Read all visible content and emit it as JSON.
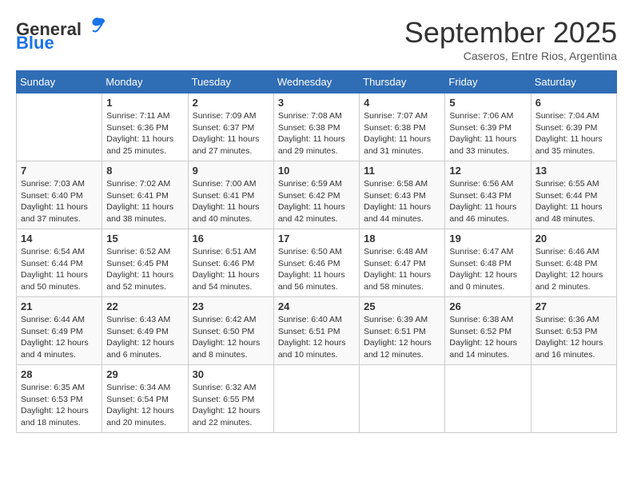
{
  "logo": {
    "line1": "General",
    "line2": "Blue"
  },
  "title": "September 2025",
  "subtitle": "Caseros, Entre Rios, Argentina",
  "days_of_week": [
    "Sunday",
    "Monday",
    "Tuesday",
    "Wednesday",
    "Thursday",
    "Friday",
    "Saturday"
  ],
  "weeks": [
    [
      {
        "day": "",
        "info": ""
      },
      {
        "day": "1",
        "info": "Sunrise: 7:11 AM\nSunset: 6:36 PM\nDaylight: 11 hours\nand 25 minutes."
      },
      {
        "day": "2",
        "info": "Sunrise: 7:09 AM\nSunset: 6:37 PM\nDaylight: 11 hours\nand 27 minutes."
      },
      {
        "day": "3",
        "info": "Sunrise: 7:08 AM\nSunset: 6:38 PM\nDaylight: 11 hours\nand 29 minutes."
      },
      {
        "day": "4",
        "info": "Sunrise: 7:07 AM\nSunset: 6:38 PM\nDaylight: 11 hours\nand 31 minutes."
      },
      {
        "day": "5",
        "info": "Sunrise: 7:06 AM\nSunset: 6:39 PM\nDaylight: 11 hours\nand 33 minutes."
      },
      {
        "day": "6",
        "info": "Sunrise: 7:04 AM\nSunset: 6:39 PM\nDaylight: 11 hours\nand 35 minutes."
      }
    ],
    [
      {
        "day": "7",
        "info": "Sunrise: 7:03 AM\nSunset: 6:40 PM\nDaylight: 11 hours\nand 37 minutes."
      },
      {
        "day": "8",
        "info": "Sunrise: 7:02 AM\nSunset: 6:41 PM\nDaylight: 11 hours\nand 38 minutes."
      },
      {
        "day": "9",
        "info": "Sunrise: 7:00 AM\nSunset: 6:41 PM\nDaylight: 11 hours\nand 40 minutes."
      },
      {
        "day": "10",
        "info": "Sunrise: 6:59 AM\nSunset: 6:42 PM\nDaylight: 11 hours\nand 42 minutes."
      },
      {
        "day": "11",
        "info": "Sunrise: 6:58 AM\nSunset: 6:43 PM\nDaylight: 11 hours\nand 44 minutes."
      },
      {
        "day": "12",
        "info": "Sunrise: 6:56 AM\nSunset: 6:43 PM\nDaylight: 11 hours\nand 46 minutes."
      },
      {
        "day": "13",
        "info": "Sunrise: 6:55 AM\nSunset: 6:44 PM\nDaylight: 11 hours\nand 48 minutes."
      }
    ],
    [
      {
        "day": "14",
        "info": "Sunrise: 6:54 AM\nSunset: 6:44 PM\nDaylight: 11 hours\nand 50 minutes."
      },
      {
        "day": "15",
        "info": "Sunrise: 6:52 AM\nSunset: 6:45 PM\nDaylight: 11 hours\nand 52 minutes."
      },
      {
        "day": "16",
        "info": "Sunrise: 6:51 AM\nSunset: 6:46 PM\nDaylight: 11 hours\nand 54 minutes."
      },
      {
        "day": "17",
        "info": "Sunrise: 6:50 AM\nSunset: 6:46 PM\nDaylight: 11 hours\nand 56 minutes."
      },
      {
        "day": "18",
        "info": "Sunrise: 6:48 AM\nSunset: 6:47 PM\nDaylight: 11 hours\nand 58 minutes."
      },
      {
        "day": "19",
        "info": "Sunrise: 6:47 AM\nSunset: 6:48 PM\nDaylight: 12 hours\nand 0 minutes."
      },
      {
        "day": "20",
        "info": "Sunrise: 6:46 AM\nSunset: 6:48 PM\nDaylight: 12 hours\nand 2 minutes."
      }
    ],
    [
      {
        "day": "21",
        "info": "Sunrise: 6:44 AM\nSunset: 6:49 PM\nDaylight: 12 hours\nand 4 minutes."
      },
      {
        "day": "22",
        "info": "Sunrise: 6:43 AM\nSunset: 6:49 PM\nDaylight: 12 hours\nand 6 minutes."
      },
      {
        "day": "23",
        "info": "Sunrise: 6:42 AM\nSunset: 6:50 PM\nDaylight: 12 hours\nand 8 minutes."
      },
      {
        "day": "24",
        "info": "Sunrise: 6:40 AM\nSunset: 6:51 PM\nDaylight: 12 hours\nand 10 minutes."
      },
      {
        "day": "25",
        "info": "Sunrise: 6:39 AM\nSunset: 6:51 PM\nDaylight: 12 hours\nand 12 minutes."
      },
      {
        "day": "26",
        "info": "Sunrise: 6:38 AM\nSunset: 6:52 PM\nDaylight: 12 hours\nand 14 minutes."
      },
      {
        "day": "27",
        "info": "Sunrise: 6:36 AM\nSunset: 6:53 PM\nDaylight: 12 hours\nand 16 minutes."
      }
    ],
    [
      {
        "day": "28",
        "info": "Sunrise: 6:35 AM\nSunset: 6:53 PM\nDaylight: 12 hours\nand 18 minutes."
      },
      {
        "day": "29",
        "info": "Sunrise: 6:34 AM\nSunset: 6:54 PM\nDaylight: 12 hours\nand 20 minutes."
      },
      {
        "day": "30",
        "info": "Sunrise: 6:32 AM\nSunset: 6:55 PM\nDaylight: 12 hours\nand 22 minutes."
      },
      {
        "day": "",
        "info": ""
      },
      {
        "day": "",
        "info": ""
      },
      {
        "day": "",
        "info": ""
      },
      {
        "day": "",
        "info": ""
      }
    ]
  ]
}
